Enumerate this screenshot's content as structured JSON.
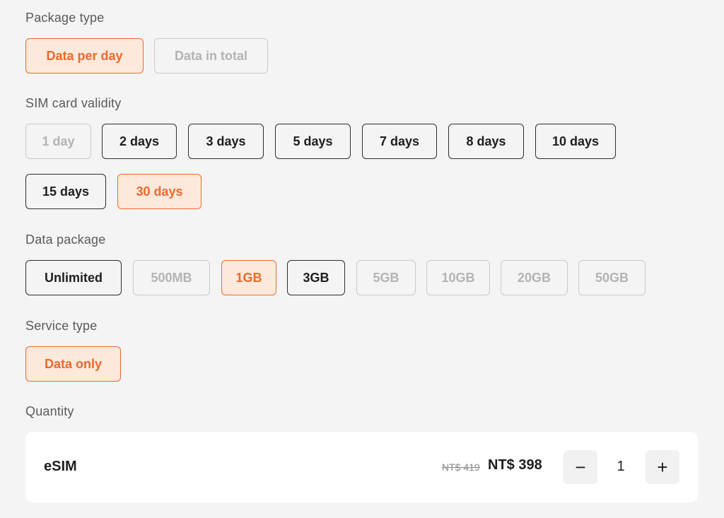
{
  "package_type": {
    "label": "Package type",
    "options": [
      {
        "label": "Data per day",
        "state": "selected"
      },
      {
        "label": "Data in total",
        "state": "disabled"
      }
    ]
  },
  "sim_validity": {
    "label": "SIM card validity",
    "options": [
      {
        "label": "1 day",
        "state": "disabled"
      },
      {
        "label": "2 days",
        "state": "normal"
      },
      {
        "label": "3 days",
        "state": "normal"
      },
      {
        "label": "5 days",
        "state": "normal"
      },
      {
        "label": "7 days",
        "state": "normal"
      },
      {
        "label": "8 days",
        "state": "normal"
      },
      {
        "label": "10 days",
        "state": "normal"
      },
      {
        "label": "15 days",
        "state": "normal"
      },
      {
        "label": "30 days",
        "state": "selected"
      }
    ]
  },
  "data_package": {
    "label": "Data package",
    "options": [
      {
        "label": "Unlimited",
        "state": "normal"
      },
      {
        "label": "500MB",
        "state": "disabled"
      },
      {
        "label": "1GB",
        "state": "selected"
      },
      {
        "label": "3GB",
        "state": "normal"
      },
      {
        "label": "5GB",
        "state": "disabled"
      },
      {
        "label": "10GB",
        "state": "disabled"
      },
      {
        "label": "20GB",
        "state": "disabled"
      },
      {
        "label": "50GB",
        "state": "disabled"
      }
    ]
  },
  "service_type": {
    "label": "Service type",
    "options": [
      {
        "label": "Data only",
        "state": "selected"
      }
    ]
  },
  "quantity": {
    "label": "Quantity",
    "item_name": "eSIM",
    "price_original": "NT$ 419",
    "price_current": "NT$ 398",
    "value": "1",
    "minus_symbol": "−",
    "plus_symbol": "+"
  },
  "colors": {
    "accent": "#ec6a2c",
    "accent_bg": "#fde8dc",
    "page_bg": "#f4f4f4",
    "card_bg": "#ffffff"
  }
}
